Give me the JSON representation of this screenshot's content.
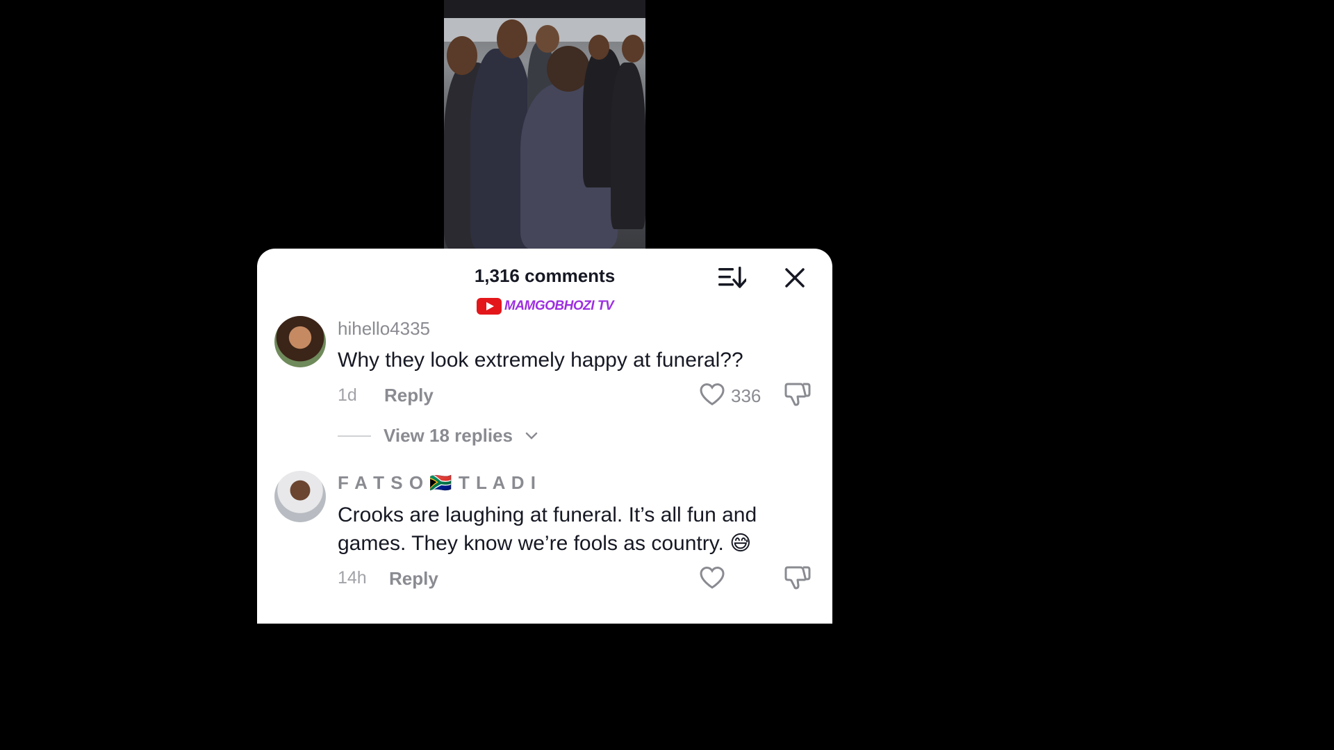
{
  "video": {
    "description_icon": "video-frame"
  },
  "sheet": {
    "title": "1,316 comments",
    "sort_icon": "sort-descending-icon",
    "close_icon": "close-icon",
    "watermark": "MAMGOBHOZI TV"
  },
  "comments": [
    {
      "username": "hihello4335",
      "text": "Why they look extremely happy at funeral??",
      "time": "1d",
      "reply_label": "Reply",
      "likes": "336",
      "view_replies": "View 18 replies"
    },
    {
      "username": "F A T S O 🇿🇦 T L A D I",
      "text": "Crooks are laughing at funeral. It’s all fun and games. They know we’re fools as country. 😅",
      "time": "14h",
      "reply_label": "Reply",
      "likes": ""
    }
  ],
  "colors": {
    "background": "#000000",
    "sheet": "#ffffff",
    "text_primary": "#161823",
    "text_secondary": "#8a8b91",
    "watermark": "#9d2fe0",
    "youtube_red": "#e3161a"
  }
}
